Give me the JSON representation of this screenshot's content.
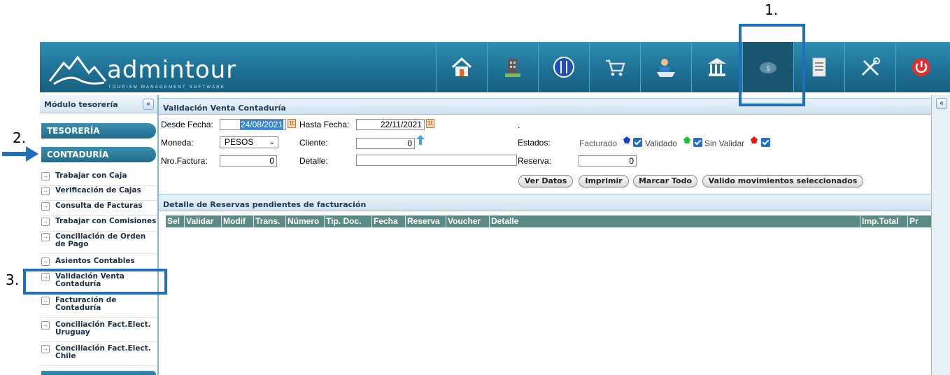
{
  "annotations": {
    "n1": "1.",
    "n2": "2.",
    "n3": "3."
  },
  "app": {
    "logo_text": "admintour",
    "logo_subtitle": "TOURISM MANAGEMENT SOFTWARE"
  },
  "nav": [
    "home-icon",
    "building-icon",
    "restaurant-icon",
    "cart-icon",
    "user-desk-icon",
    "bank-icon",
    "piggy-bank-icon",
    "document-icon",
    "tools-icon",
    "power-icon"
  ],
  "sidebar": {
    "title": "Módulo tesorería",
    "collapse": "«",
    "section1": "TESORERÍA",
    "section2": "CONTADURÍA",
    "items": [
      {
        "label": "Trabajar con Caja"
      },
      {
        "label": "Verificación de Cajas"
      },
      {
        "label": "Consulta de Facturas"
      },
      {
        "label": "Trabajar con Comisiones"
      },
      {
        "label": "Conciliación de Orden de Pago"
      },
      {
        "label": "Asientos Contables"
      },
      {
        "label": "Validación Venta Contaduría"
      },
      {
        "label": "Facturación de Contaduría"
      },
      {
        "label": "Conciliación Fact.Elect. Uruguay"
      },
      {
        "label": "Conciliación Fact.Elect. Chile"
      }
    ]
  },
  "form": {
    "title": "Validación Venta Contaduría",
    "desde_label": "Desde Fecha:",
    "desde_value": "24/08/2021",
    "hasta_label": "Hasta Fecha:",
    "hasta_value": "22/11/2021",
    "dot": ".",
    "moneda_label": "Moneda:",
    "moneda_value": "PESOS",
    "cliente_label": "Cliente:",
    "cliente_value": "0",
    "estados_label": "Estados:",
    "facturado_label": "Facturado",
    "validado_label": "Validado",
    "sinvalidar_label": "Sin Validar",
    "nro_label": "Nro.Factura:",
    "nro_value": "0",
    "detalle_label": "Detalle:",
    "detalle_value": "",
    "reserva_label": "Reserva:",
    "reserva_value": "0",
    "buttons": {
      "ver": "Ver Datos",
      "imprimir": "Imprimir",
      "marcar": "Marcar Todo",
      "valido": "Valido movimientos seleccionados"
    }
  },
  "detail": {
    "title": "Detalle de Reservas pendientes de facturación",
    "columns": [
      "Sel",
      "Validar",
      "Modif",
      "Trans.",
      "Número",
      "Tip. Doc.",
      "Fecha",
      "Reserva",
      "Voucher",
      "Detalle",
      "Imp.Total",
      "Pr"
    ]
  },
  "colors": {
    "header": "#1d6f93",
    "accent": "#1f6fc0",
    "grid_head": "#5e8a85"
  }
}
